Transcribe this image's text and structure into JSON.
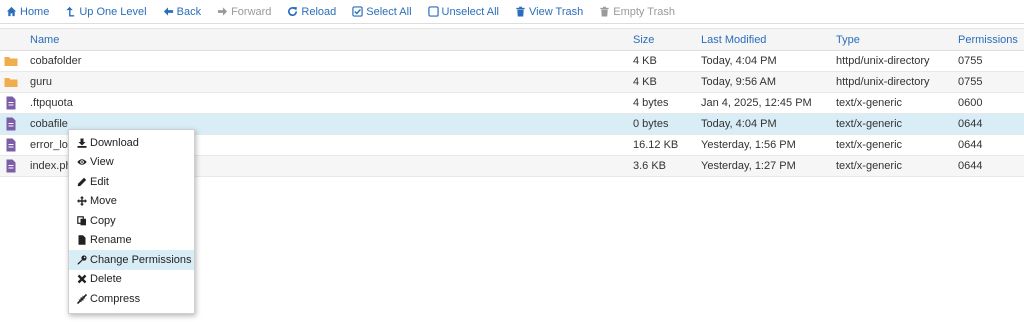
{
  "toolbar": {
    "items": [
      {
        "label": "Home",
        "icon": "home-icon"
      },
      {
        "label": "Up One Level",
        "icon": "level-up-icon"
      },
      {
        "label": "Back",
        "icon": "arrow-left-icon"
      },
      {
        "label": "Forward",
        "icon": "arrow-right-icon"
      },
      {
        "label": "Reload",
        "icon": "reload-icon"
      },
      {
        "label": "Select All",
        "icon": "checkbox-checked-icon"
      },
      {
        "label": "Unselect All",
        "icon": "checkbox-empty-icon"
      },
      {
        "label": "View Trash",
        "icon": "trash-icon"
      },
      {
        "label": "Empty Trash",
        "icon": "trash-icon"
      }
    ]
  },
  "table": {
    "headers": {
      "name": "Name",
      "size": "Size",
      "modified": "Last Modified",
      "type": "Type",
      "permissions": "Permissions"
    },
    "rows": [
      {
        "name": "cobafolder",
        "size": "4 KB",
        "modified": "Today, 4:04 PM",
        "type": "httpd/unix-directory",
        "permissions": "0755",
        "icon": "folder-icon"
      },
      {
        "name": "guru",
        "size": "4 KB",
        "modified": "Today, 9:56 AM",
        "type": "httpd/unix-directory",
        "permissions": "0755",
        "icon": "folder-icon"
      },
      {
        "name": ".ftpquota",
        "size": "4 bytes",
        "modified": "Jan 4, 2025, 12:45 PM",
        "type": "text/x-generic",
        "permissions": "0600",
        "icon": "file-icon"
      },
      {
        "name": "cobafile",
        "size": "0 bytes",
        "modified": "Today, 4:04 PM",
        "type": "text/x-generic",
        "permissions": "0644",
        "icon": "file-icon"
      },
      {
        "name": "error_log",
        "size": "16.12 KB",
        "modified": "Yesterday, 1:56 PM",
        "type": "text/x-generic",
        "permissions": "0644",
        "icon": "file-icon"
      },
      {
        "name": "index.php",
        "size": "3.6 KB",
        "modified": "Yesterday, 1:27 PM",
        "type": "text/x-generic",
        "permissions": "0644",
        "icon": "file-icon"
      }
    ]
  },
  "context_menu": {
    "items": [
      {
        "label": "Download",
        "icon": "download-icon"
      },
      {
        "label": "View",
        "icon": "eye-icon"
      },
      {
        "label": "Edit",
        "icon": "pencil-icon"
      },
      {
        "label": "Move",
        "icon": "move-icon"
      },
      {
        "label": "Copy",
        "icon": "copy-icon"
      },
      {
        "label": "Rename",
        "icon": "file-icon"
      },
      {
        "label": "Change Permissions",
        "icon": "key-icon"
      },
      {
        "label": "Delete",
        "icon": "close-icon"
      },
      {
        "label": "Compress",
        "icon": "compress-icon"
      }
    ]
  },
  "colors": {
    "link": "#2a6ebb",
    "disabled": "#9a9a9a",
    "selected_row": "#d9edf7",
    "folder": "#f0ad4e",
    "file": "#7b5ea7"
  }
}
